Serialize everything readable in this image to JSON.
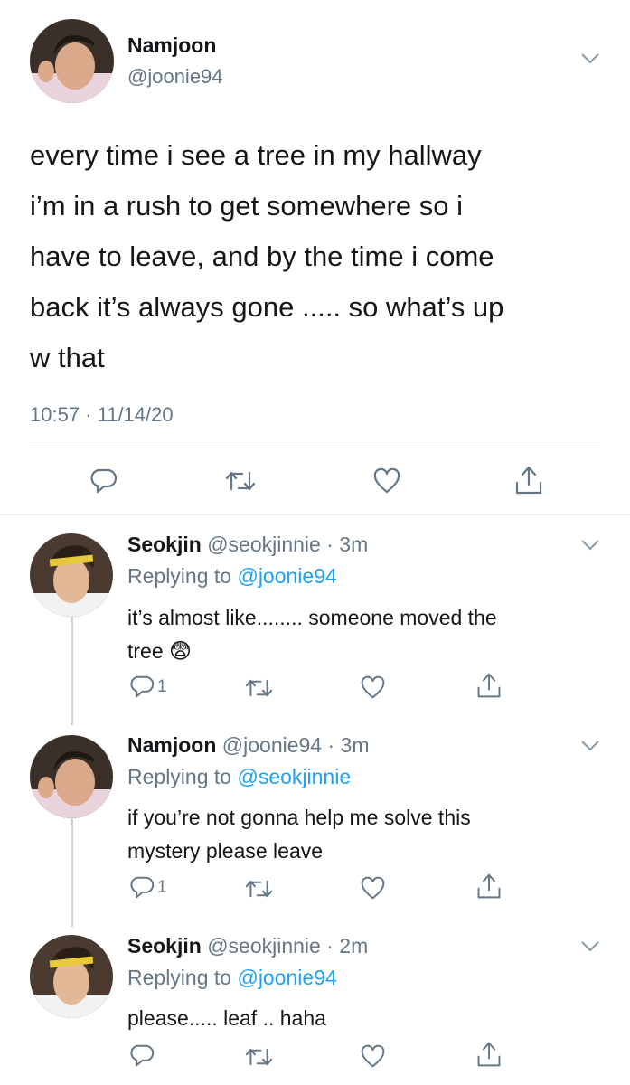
{
  "main_tweet": {
    "display_name": "Namjoon",
    "handle": "@joonie94",
    "text_lines": [
      "every time i see a tree in my hallway",
      "i’m in a rush to get somewhere so i",
      "have to leave, and by the time i come",
      "back it’s always gone ..... so what’s up",
      "w that"
    ],
    "timestamp": "10:57 · 11/14/20"
  },
  "replies": [
    {
      "display_name": "Seokjin",
      "handle": "@seokjinnie",
      "time": "· 3m",
      "replying_label": "Replying to",
      "replying_to": "@joonie94",
      "text_lines": [
        "it’s almost like........ someone moved the",
        "tree"
      ],
      "emoji": "😨",
      "reply_count": "1"
    },
    {
      "display_name": "Namjoon",
      "handle": "@joonie94",
      "time": "· 3m",
      "replying_label": "Replying to",
      "replying_to": "@seokjinnie",
      "text_lines": [
        "if you’re not gonna help me solve this",
        "mystery please leave"
      ],
      "reply_count": "1"
    },
    {
      "display_name": "Seokjin",
      "handle": "@seokjinnie",
      "time": "· 2m",
      "replying_label": "Replying to",
      "replying_to": "@joonie94",
      "text_lines": [
        "please..... leaf .. haha"
      ],
      "reply_count": ""
    }
  ],
  "icons": {
    "reply": "reply-icon",
    "retweet": "retweet-icon",
    "like": "heart-icon",
    "share": "share-icon",
    "more": "chevron-down-icon"
  },
  "colors": {
    "text": "#14171a",
    "muted": "#657786",
    "link": "#1da1f2",
    "divider": "#e1e8ed",
    "thread": "#ccd6dd"
  }
}
